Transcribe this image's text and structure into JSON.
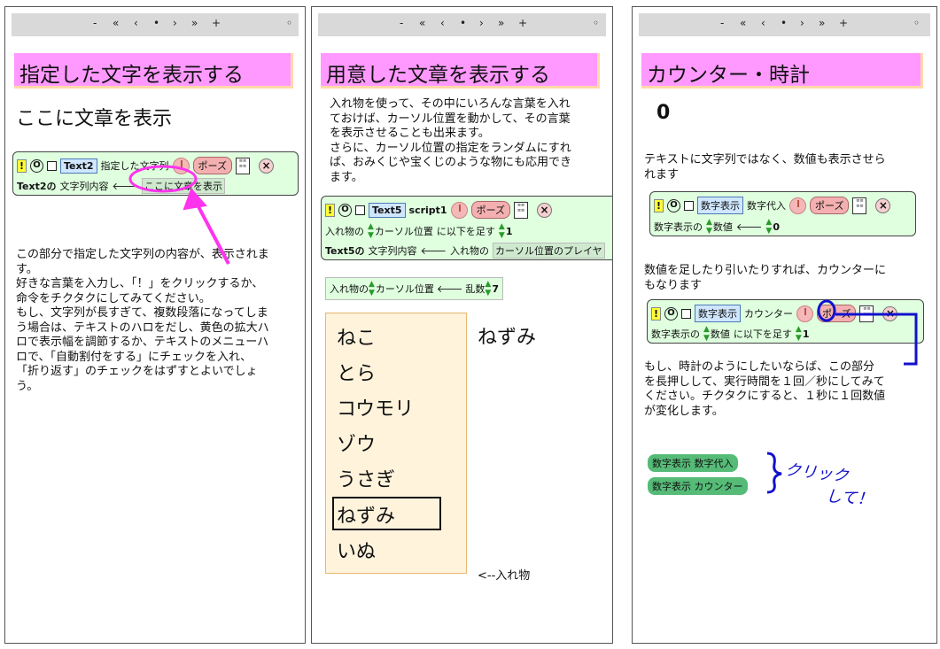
{
  "nav": {
    "minus": "-",
    "first": "«",
    "prev": "‹",
    "dot": "•",
    "next": "›",
    "last": "»",
    "plus": "+",
    "menu": "◦"
  },
  "colors": {
    "title_bg": "#ff99ff",
    "script_bg": "#dfffdf",
    "annotation_magenta": "#ff33ee",
    "annotation_blue": "#1111cc"
  },
  "panel1": {
    "title": "指定した文字を表示する",
    "display_text": "ここに文章を表示",
    "script": {
      "excl": "!",
      "circle": "O",
      "name": "Text2",
      "label": "指定した文字列",
      "pause": "ポーズ",
      "close": "×",
      "row2_target": "Text2の",
      "row2_prop": "文字列内容",
      "row2_arrow": "🡐",
      "row2_value": "ここに文章を表示"
    },
    "paragraph": [
      "この部分で指定した文字列の内容が、表示されま",
      "す。",
      "好きな言葉を入力し、「！」をクリックするか、",
      "命令をチクタクにしてみてください。",
      "もし、文字列が長すぎて、複数段落になってしま",
      "う場合は、テキストのハロをだし、黄色の拡大ハ",
      "ロで表示幅を調節するか、テキストのメニューハ",
      "ロで、「自動割付をする」にチェックを入れ、",
      "「折り返す」のチェックをはずすとよいでしょ",
      "う。"
    ]
  },
  "panel2": {
    "title": "用意した文章を表示する",
    "paragraph": [
      "入れ物を使って、その中にいろんな言葉を入れ",
      "ておけば、カーソル位置を動かして、その言葉",
      "を表示させることも出来ます。",
      "さらに、カーソル位置の指定をランダムにすれ",
      "ば、おみくじや宝くじのような物にも応用でき",
      "ます。"
    ],
    "script": {
      "excl": "!",
      "circle": "O",
      "name": "Text5",
      "label": "script1",
      "pause": "ポーズ",
      "close": "×",
      "row2_a": "入れ物の",
      "row2_b": "カーソル位置",
      "row2_c": "に以下を足す",
      "row2_value": "1",
      "row3_a": "Text5の",
      "row3_b": "文字列内容",
      "row3_arrow": "🡐",
      "row3_c": "入れ物の",
      "row3_d": "カーソル位置のプレイヤ"
    },
    "tile": {
      "a": "入れ物の",
      "b": "カーソル位置",
      "arrow": "🡐",
      "c": "乱数",
      "value": "7"
    },
    "holder_items": [
      "ねこ",
      "とら",
      "コウモリ",
      "ゾウ",
      "うさぎ",
      "ねずみ",
      "いぬ"
    ],
    "display_text": "ねずみ",
    "holder_label": "<--入れ物"
  },
  "panel3": {
    "title": "カウンター・時計",
    "counter": "0",
    "paragraph1": [
      "テキストに文字列ではなく、数値も表示させら",
      "れます"
    ],
    "script1": {
      "excl": "!",
      "circle": "O",
      "name": "数字表示",
      "label": "数字代入",
      "pause": "ポーズ",
      "close": "×",
      "row2_a": "数字表示の",
      "row2_b": "数値",
      "row2_arrow": "🡐",
      "row2_value": "0"
    },
    "paragraph2": [
      "数値を足したり引いたりすれば、カウンターに",
      "もなります"
    ],
    "script2": {
      "excl": "!",
      "circle": "O",
      "name": "数字表示",
      "label": "カウンター",
      "pause": "ポーズ",
      "close": "×",
      "row2_a": "数字表示の",
      "row2_b": "数値",
      "row2_c": "に以下を足す",
      "row2_value": "1"
    },
    "paragraph3": [
      "もし、時計のようにしたいならば、この部分",
      "を長押しして、実行時間を１回／秒にしてみて",
      "ください。チクタクにすると、１秒に１回数値",
      "が変化します。"
    ],
    "buttons": [
      "数字表示 数字代入",
      "数字表示 カウンター"
    ],
    "handwritten_1": "クリック",
    "handwritten_2": "して！"
  }
}
